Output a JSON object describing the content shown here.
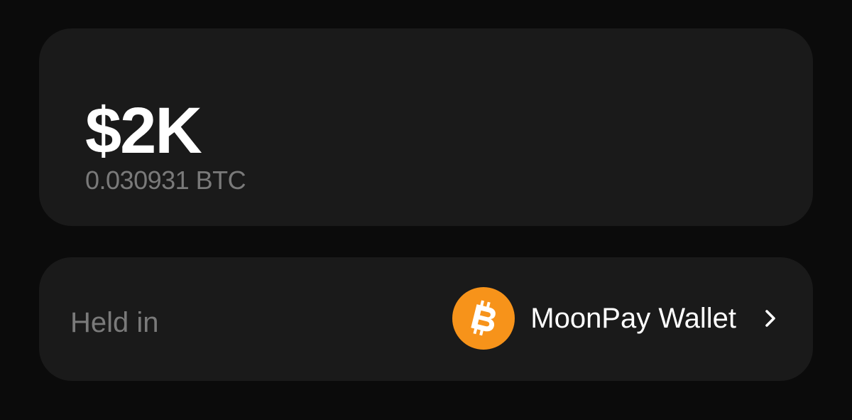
{
  "balance": {
    "fiat_value": "$2K",
    "crypto_value": "0.030931 BTC"
  },
  "holding": {
    "label": "Held in",
    "wallet_name": "MoonPay Wallet",
    "wallet_icon": "bitcoin-icon",
    "action_icon": "chevron-right-icon"
  },
  "colors": {
    "background": "#0b0b0b",
    "card": "#1a1a1a",
    "primary_text": "#ffffff",
    "secondary_text": "#7a7a7a",
    "bitcoin_orange": "#f7931a"
  }
}
